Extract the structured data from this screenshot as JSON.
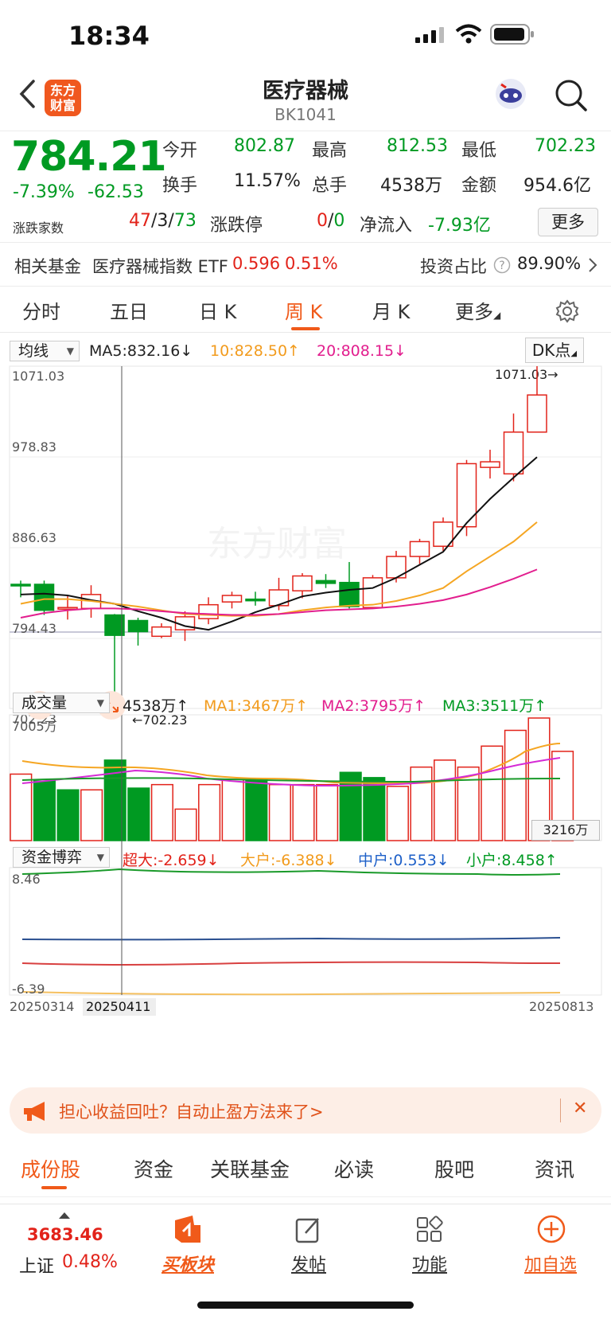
{
  "status": {
    "time": "18:34"
  },
  "nav": {
    "title": "医疗器械",
    "code": "BK1041",
    "logo_text": "东方\n财富"
  },
  "quote": {
    "price": "784.21",
    "change_pct": "-7.39%",
    "change": "-62.53",
    "open_label": "今开",
    "open": "802.87",
    "high_label": "最高",
    "high": "812.53",
    "low_label": "最低",
    "low": "702.23",
    "turnover_label": "换手",
    "turnover": "11.57%",
    "volume_label": "总手",
    "volume": "4538万",
    "amount_label": "金额",
    "amount": "954.6亿",
    "updown_label": "涨跌家数",
    "up": "47",
    "flat": "3",
    "down": "73",
    "limit_label": "涨跌停",
    "limit_up": "0",
    "limit_down": "0",
    "netflow_label": "净流入",
    "netflow": "-7.93亿",
    "more_label": "更多"
  },
  "fund": {
    "label": "相关基金",
    "name": "医疗器械指数 ETF",
    "price": "0.596",
    "pct": "0.51%",
    "ratio_label": "投资占比",
    "ratio": "89.90%"
  },
  "tabs": [
    "分时",
    "五日",
    "日 K",
    "周 K",
    "月 K",
    "更多"
  ],
  "active_tab": "周 K",
  "ma_legend": {
    "selector": "均线",
    "ma5": "MA5:832.16↓",
    "ma10": "10:828.50↑",
    "ma20": "20:808.15↓",
    "dk": "DK点"
  },
  "price_axis": {
    "max": "1071.03",
    "l2": "978.83",
    "l3": "886.63",
    "l4": "794.43",
    "min": "702.23",
    "max_marker": "1071.03→",
    "min_marker": "←702.23"
  },
  "vol_legend": {
    "selector": "成交量",
    "vol": "4538万↑",
    "ma1": "MA1:3467万↑",
    "ma2": "MA2:3795万↑",
    "ma3": "MA3:3511万↑",
    "max": "7005万",
    "tag": "3216万"
  },
  "flow_legend": {
    "selector": "资金博弈",
    "super": "超大:-2.659↓",
    "big": "大户:-6.388↓",
    "mid": "中户:0.553↓",
    "small": "小户:8.458↑",
    "max": "8.46",
    "min": "-6.39"
  },
  "dates": {
    "start": "20250314",
    "cursor": "20250411",
    "end": "20250813"
  },
  "watermark": "东方财富",
  "banner": {
    "text": "担心收益回吐？自动止盈方法来了>",
    "close": "✕"
  },
  "section_tabs": [
    "成份股",
    "资金",
    "关联基金",
    "必读",
    "股吧",
    "资讯"
  ],
  "bottom": {
    "index_value": "3683.46",
    "index_name": "上证",
    "index_pct": "0.48%",
    "buy": "买板块",
    "post": "发帖",
    "func": "功能",
    "add": "加自选"
  },
  "colors": {
    "up": "#e2231a",
    "down": "#009a22",
    "accent": "#f05a1a",
    "ma5": "#111111",
    "ma10": "#f5a623",
    "ma20": "#e21e8e"
  },
  "chart_data": {
    "type": "candlestick",
    "period": "weekly",
    "ylim": [
      702.23,
      1071.03
    ],
    "x": [
      "20250314",
      "20250411",
      "20250813"
    ],
    "candles": [
      {
        "o": 836,
        "c": 835,
        "h": 840,
        "l": 822
      },
      {
        "o": 836,
        "c": 808,
        "h": 840,
        "l": 803
      },
      {
        "o": 811,
        "c": 811,
        "h": 824,
        "l": 798
      },
      {
        "o": 810,
        "c": 825,
        "h": 835,
        "l": 800
      },
      {
        "o": 803,
        "c": 781,
        "h": 804,
        "l": 702
      },
      {
        "o": 797,
        "c": 785,
        "h": 800,
        "l": 770
      },
      {
        "o": 780,
        "c": 790,
        "h": 794,
        "l": 778
      },
      {
        "o": 787,
        "c": 801,
        "h": 807,
        "l": 775
      },
      {
        "o": 799,
        "c": 814,
        "h": 822,
        "l": 793
      },
      {
        "o": 817,
        "c": 824,
        "h": 828,
        "l": 810
      },
      {
        "o": 820,
        "c": 819,
        "h": 828,
        "l": 813
      },
      {
        "o": 813,
        "c": 830,
        "h": 843,
        "l": 808
      },
      {
        "o": 829,
        "c": 845,
        "h": 848,
        "l": 821
      },
      {
        "o": 840,
        "c": 837,
        "h": 847,
        "l": 832
      },
      {
        "o": 838,
        "c": 812,
        "h": 860,
        "l": 810
      },
      {
        "o": 811,
        "c": 843,
        "h": 846,
        "l": 810
      },
      {
        "o": 843,
        "c": 866,
        "h": 872,
        "l": 838
      },
      {
        "o": 866,
        "c": 882,
        "h": 885,
        "l": 858
      },
      {
        "o": 877,
        "c": 903,
        "h": 908,
        "l": 872
      },
      {
        "o": 898,
        "c": 966,
        "h": 970,
        "l": 888
      },
      {
        "o": 962,
        "c": 968,
        "h": 981,
        "l": 950
      },
      {
        "o": 955,
        "c": 1000,
        "h": 1020,
        "l": 947
      },
      {
        "o": 1000,
        "c": 1040,
        "h": 1071,
        "l": 1000
      }
    ],
    "ma5": [
      825,
      826,
      824,
      819,
      815,
      807,
      800,
      791,
      787,
      796,
      806,
      814,
      823,
      827,
      830,
      832,
      843,
      857,
      871,
      902,
      928,
      951,
      973
    ],
    "ma10": [
      815,
      820,
      820,
      818,
      815,
      812,
      808,
      804,
      803,
      802,
      802,
      804,
      808,
      811,
      813,
      814,
      818,
      824,
      832,
      850,
      866,
      882,
      903
    ],
    "ma20": [
      800,
      805,
      808,
      810,
      810,
      809,
      807,
      805,
      804,
      803,
      803,
      804,
      806,
      808,
      809,
      810,
      812,
      815,
      819,
      825,
      833,
      842,
      852
    ],
    "volume": [
      3800,
      3400,
      2900,
      2900,
      4600,
      3000,
      3200,
      1800,
      3200,
      3500,
      3500,
      3200,
      3200,
      3200,
      3900,
      3600,
      3100,
      4200,
      4600,
      4200,
      5400,
      6300,
      7005,
      5100
    ],
    "volume_up": [
      true,
      false,
      false,
      true,
      false,
      false,
      true,
      true,
      true,
      true,
      false,
      true,
      true,
      true,
      false,
      false,
      true,
      true,
      true,
      true,
      true,
      true,
      true,
      true
    ]
  }
}
